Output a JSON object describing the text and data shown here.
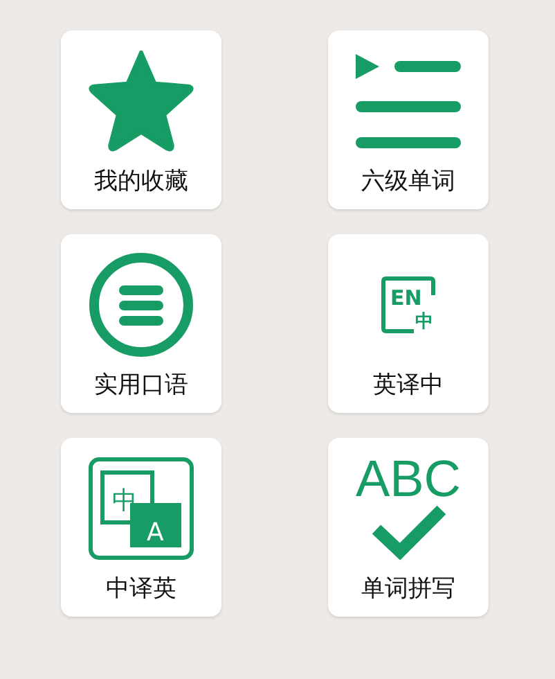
{
  "rows": [
    {
      "tiles": [
        {
          "kind": "star",
          "label": "我的收藏"
        },
        {
          "kind": "list",
          "label": "六级单词"
        }
      ]
    },
    {
      "tiles": [
        {
          "kind": "menu-circle",
          "label": "实用口语"
        },
        {
          "kind": "en-zh",
          "label": "英译中",
          "glyphs": [
            "EN",
            "中"
          ]
        }
      ]
    },
    {
      "tiles": [
        {
          "kind": "zh-en",
          "label": "中译英",
          "glyphs": [
            "中",
            "A"
          ]
        },
        {
          "kind": "spelling",
          "label": "单词拼写",
          "glyphs": [
            "ABC"
          ]
        }
      ]
    }
  ]
}
